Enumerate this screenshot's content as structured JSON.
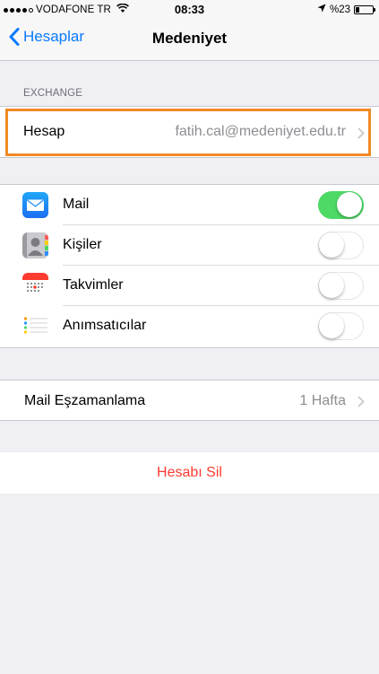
{
  "status_bar": {
    "carrier": "VODAFONE TR",
    "time": "08:33",
    "battery": "%23",
    "battery_level": 0.23,
    "signal_dots_filled": 4,
    "signal_dots_total": 5
  },
  "nav": {
    "back_label": "Hesaplar",
    "title": "Medeniyet"
  },
  "account_section": {
    "header": "EXCHANGE",
    "row_label": "Hesap",
    "row_value": "fatih.cal@medeniyet.edu.tr"
  },
  "toggles": [
    {
      "label": "Mail",
      "on": true,
      "icon": "mail-icon"
    },
    {
      "label": "Kişiler",
      "on": false,
      "icon": "contacts-icon"
    },
    {
      "label": "Takvimler",
      "on": false,
      "icon": "calendar-icon"
    },
    {
      "label": "Anımsatıcılar",
      "on": false,
      "icon": "reminders-icon"
    }
  ],
  "sync": {
    "label": "Mail Eşzamanlama",
    "value": "1 Hafta"
  },
  "delete": {
    "label": "Hesabı Sil"
  },
  "colors": {
    "accent": "#0a7aff",
    "toggle_on": "#4cd964",
    "destructive": "#ff3b30",
    "highlight": "#f08a24"
  }
}
